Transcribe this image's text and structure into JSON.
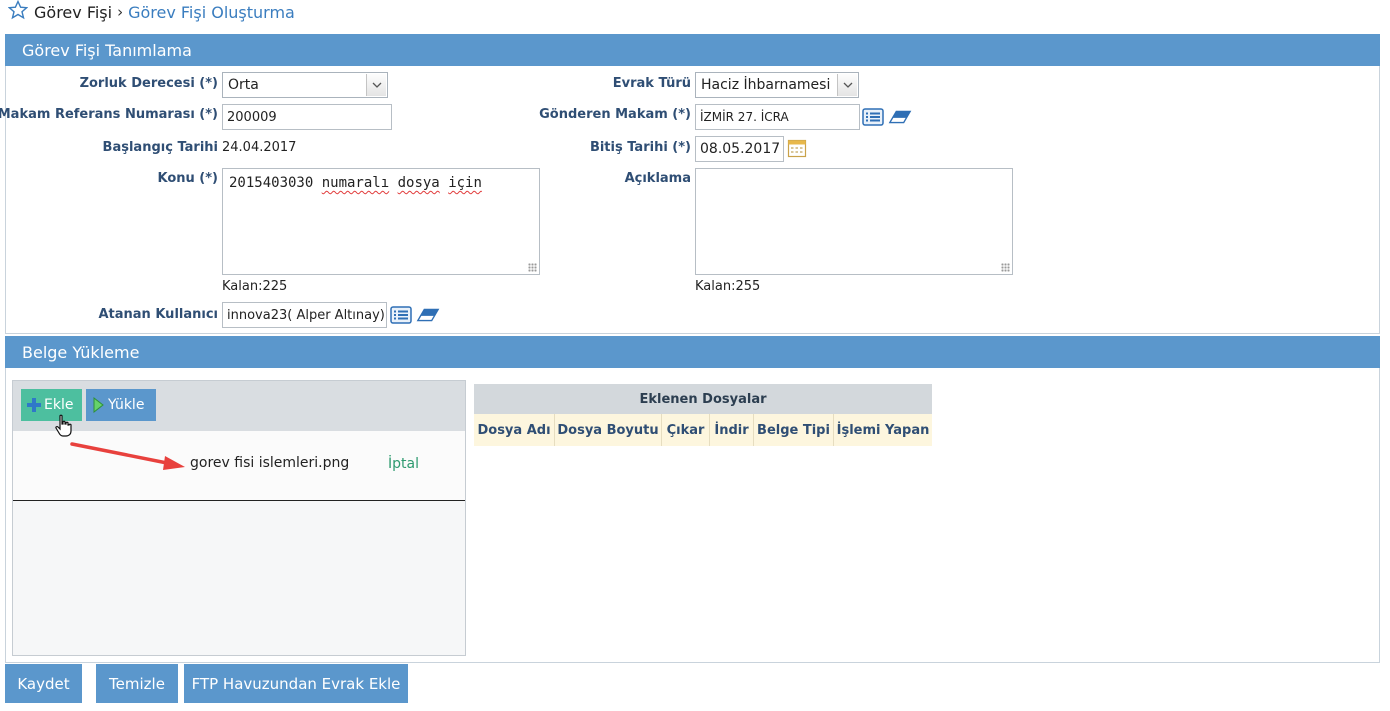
{
  "breadcrumb": {
    "home": "Görev Fişi",
    "separator": "›",
    "current": "Görev Fişi Oluşturma"
  },
  "form_section": {
    "title": "Görev Fişi Tanımlama",
    "difficulty": {
      "label": "Zorluk Derecesi (*)",
      "value": "Orta"
    },
    "doc_type": {
      "label": "Evrak Türü",
      "value": "Haciz İhbarnamesi"
    },
    "ref_no": {
      "label": "Makam Referans Numarası (*)",
      "value": "200009"
    },
    "sender": {
      "label": "Gönderen Makam (*)",
      "value": "İZMİR 27. İCRA"
    },
    "start_date": {
      "label": "Başlangıç Tarihi",
      "value": "24.04.2017"
    },
    "end_date": {
      "label": "Bitiş Tarihi (*)",
      "value": "08.05.2017"
    },
    "subject": {
      "label": "Konu (*)",
      "value_plain": "2015403030 ",
      "value_word1": "numaralı",
      "value_space": " ",
      "value_word2": "dosya",
      "value_word3": "için",
      "remaining": "Kalan:225"
    },
    "description": {
      "label": "Açıklama",
      "value": "",
      "remaining": "Kalan:255"
    },
    "assigned_user": {
      "label": "Atanan Kullanıcı",
      "value": "innova23( Alper Altınay)"
    }
  },
  "upload_section": {
    "title": "Belge Yükleme",
    "add_button": "Ekle",
    "upload_button": "Yükle",
    "pending_file": {
      "name": "gorev fisi islemleri.png",
      "cancel": "İptal"
    }
  },
  "files_table": {
    "caption": "Eklenen Dosyalar",
    "columns": [
      "Dosya Adı",
      "Dosya Boyutu",
      "Çıkar",
      "İndir",
      "Belge Tipi",
      "İşlemi Yapan"
    ]
  },
  "actions": {
    "save": "Kaydet",
    "clear": "Temizle",
    "ftp": "FTP Havuzundan Evrak Ekle"
  },
  "colors": {
    "header_blue": "#5b97cc",
    "label_blue": "#2f4e74",
    "link_blue": "#3a7dbf",
    "add_green": "#4dbf9f",
    "cancel_green": "#2e9a6f",
    "arrow_red": "#e8413d"
  }
}
